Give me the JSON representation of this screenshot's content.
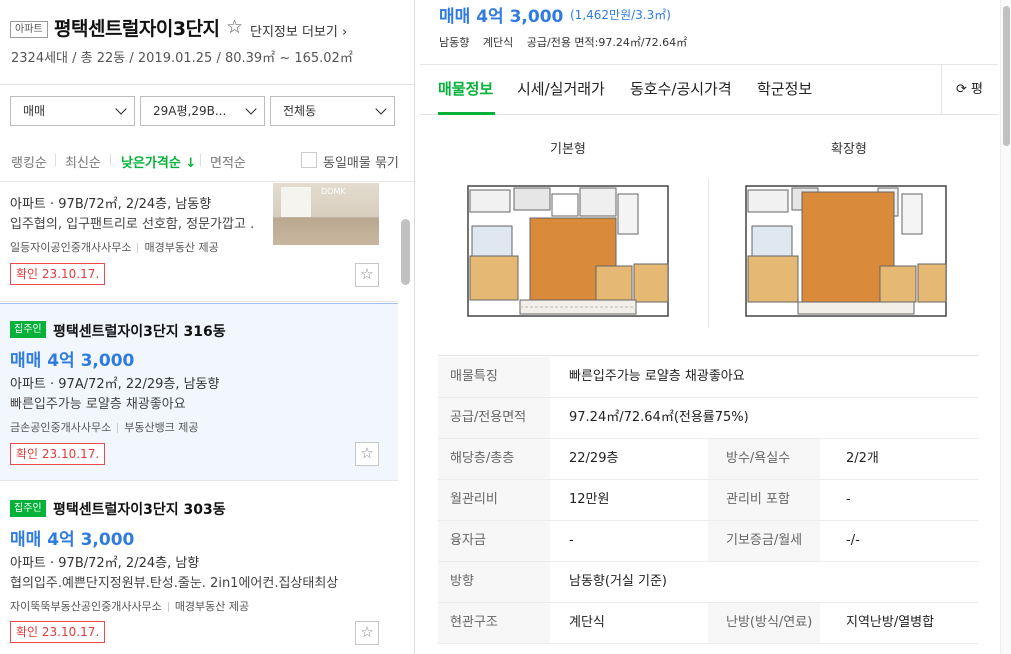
{
  "complex": {
    "type_tag": "아파트",
    "name": "평택센트럴자이3단지",
    "more_link": "단지정보 더보기",
    "info": "2324세대 / 총 22동 / 2019.01.25 / 80.39㎡ ~ 165.02㎡"
  },
  "filters": {
    "trade_type": "매매",
    "area": "29A평,29B...",
    "building": "전체동"
  },
  "sort": {
    "options": [
      "랭킹순",
      "최신순",
      "낮은가격순 ↓",
      "면적순"
    ],
    "active_index": 2,
    "group_same": "동일매물 묶기"
  },
  "listings": [
    {
      "spec": "아파트 · 97B/72㎡, 2/24층, 남동향",
      "desc": "입주협의, 입구팬트리로 선호함, 정문가깝고 ...",
      "agent": "일등자이공인중개사사무소",
      "provider": "매경부동산 제공",
      "confirm": "확인 23.10.17.",
      "thumb_watermark": "DOMK"
    },
    {
      "badge": "집주인",
      "title": "평택센트럴자이3단지 316동",
      "price": "매매 4억 3,000",
      "spec": "아파트 · 97A/72㎡, 22/29층, 남동향",
      "desc": "빠른입주가능 로얄층 채광좋아요",
      "agent": "금손공인중개사사무소",
      "provider": "부동산뱅크 제공",
      "confirm": "확인 23.10.17."
    },
    {
      "badge": "집주인",
      "title": "평택센트럴자이3단지 303동",
      "price": "매매 4억 3,000",
      "spec": "아파트 · 97B/72㎡, 2/24층, 남향",
      "desc": "협의입주.예쁜단지정원뷰.탄성.줄눈. 2in1에어컨.집상태최상",
      "agent": "자이뚝뚝부동산공인중개사사무소",
      "provider": "매경부동산 제공",
      "confirm": "확인 23.10.17."
    }
  ],
  "detail": {
    "price": "매매 4억 3,000",
    "price_per_pyeong": "(1,462만원/3.3㎡)",
    "meta": [
      "남동향",
      "계단식",
      "공급/전용 면적:97.24㎡/72.64㎡"
    ],
    "tabs": [
      "매물정보",
      "시세/실거래가",
      "동호수/공시가격",
      "학군정보"
    ],
    "active_tab": 0,
    "refresh_label": "평",
    "plans": {
      "basic": "기본형",
      "extended": "확장형"
    },
    "spec_rows": [
      {
        "label": "매물특징",
        "value": "빠른입주가능 로얄층 채광좋아요"
      },
      {
        "label": "공급/전용면적",
        "value": "97.24㎡/72.64㎡(전용률75%)"
      },
      {
        "label": "해당층/총층",
        "value": "22/29층",
        "label2": "방수/욕실수",
        "value2": "2/2개"
      },
      {
        "label": "월관리비",
        "value": "12만원",
        "label2": "관리비 포함",
        "value2": "-"
      },
      {
        "label": "융자금",
        "value": "-",
        "label2": "기보증금/월세",
        "value2": "-/-"
      },
      {
        "label": "방향",
        "value": "남동향(거실 기준)"
      },
      {
        "label": "현관구조",
        "value": "계단식",
        "label2": "난방(방식/연료)",
        "value2": "지역난방/열병합"
      }
    ]
  },
  "colors": {
    "accent_green": "#06b13a",
    "price_blue": "#2f7be0",
    "confirm_red": "#e23b3b"
  }
}
